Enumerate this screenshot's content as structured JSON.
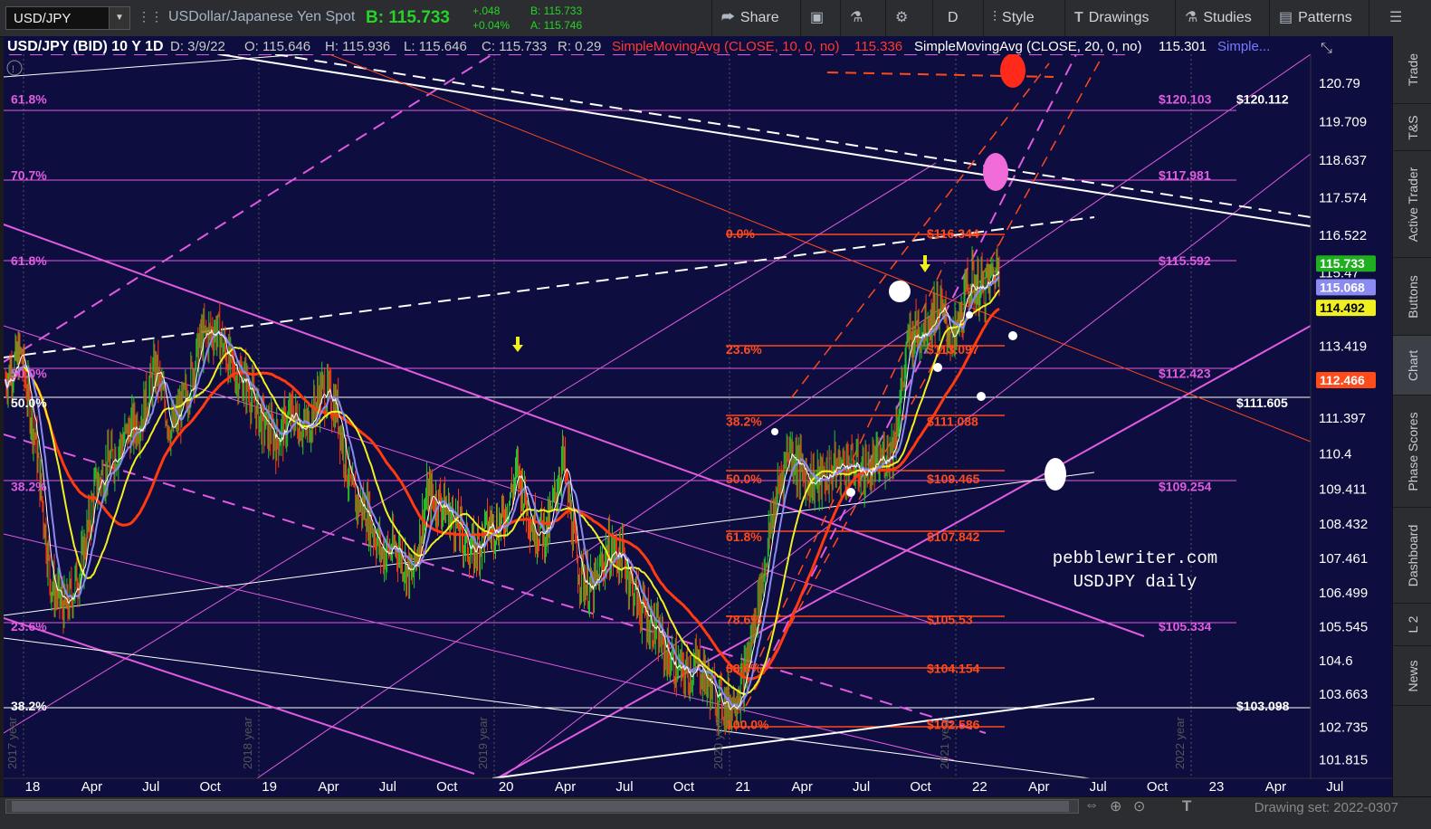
{
  "toolbar": {
    "symbol": "USD/JPY",
    "description": "USDollar/Japanese Yen Spot",
    "bid_label": "B: 115.733",
    "change_abs": "+.048",
    "change_pct": "+0.04%",
    "bid_small": "B: 115.733",
    "ask_small": "A: 115.746",
    "share": "Share",
    "interval": "D",
    "style": "Style",
    "drawings": "Drawings",
    "studies": "Studies",
    "patterns": "Patterns"
  },
  "right_tabs": [
    "Trade",
    "T&S",
    "Active Trader",
    "Buttons",
    "Chart",
    "Phase Scores",
    "Dashboard",
    "L 2",
    "News"
  ],
  "bottom": {
    "drawing_set": "Drawing set: 2022-0307"
  },
  "header": {
    "title": "USD/JPY (BID) 10 Y 1D",
    "date": "D: 3/9/22",
    "open": "O: 115.646",
    "high": "H: 115.936",
    "low": "L: 115.646",
    "close": "C: 115.733",
    "range": "R: 0.29",
    "sma10": "SimpleMovingAvg (CLOSE, 10, 0, no)",
    "sma10_val": "115.336",
    "sma20": "SimpleMovingAvg (CLOSE, 20, 0, no)",
    "sma20_val": "115.301",
    "more": "Simple..."
  },
  "watermark": {
    "line1": "pebblewriter.com",
    "line2": "USDJPY daily"
  },
  "colors": {
    "bg": "#0d0d3f",
    "magenta": "#e15be0",
    "orange": "#ff4a1a",
    "white": "#ffffff",
    "yellow": "#f0f020",
    "blue": "#8a8af0",
    "green": "#27d327"
  },
  "chart_data": {
    "type": "candlestick",
    "ylim": [
      101.3,
      121.6
    ],
    "y_ticks": [
      "120.79",
      "119.709",
      "118.637",
      "117.574",
      "116.522",
      "115.47",
      "113.419",
      "112.398",
      "111.397",
      "110.4",
      "109.411",
      "108.432",
      "107.461",
      "106.499",
      "105.545",
      "104.6",
      "103.663",
      "102.735",
      "101.815"
    ],
    "x_ticks": [
      "18",
      "Apr",
      "Jul",
      "Oct",
      "19",
      "Apr",
      "Jul",
      "Oct",
      "20",
      "Apr",
      "Jul",
      "Oct",
      "21",
      "Apr",
      "Jul",
      "Oct",
      "22",
      "Apr",
      "Jul",
      "Oct",
      "23",
      "Apr",
      "Jul"
    ],
    "year_labels": [
      "2017 year",
      "2018 year",
      "2019 year",
      "2020 year",
      "2021 year",
      "2022 year"
    ],
    "price_markers": [
      {
        "label": "115.733",
        "value": 115.733,
        "color": "#1fae1f"
      },
      {
        "label": "115.068",
        "value": 115.068,
        "color": "#8a8af0"
      },
      {
        "label": "114.492",
        "value": 114.492,
        "color": "#f0f020"
      },
      {
        "label": "112.466",
        "value": 112.466,
        "color": "#ff4a1a"
      }
    ],
    "fib_magenta": [
      {
        "label": "61.8%",
        "value": 120.112,
        "price": "$120.103"
      },
      {
        "label": "70.7%",
        "value": 117.98,
        "price": "$117.981"
      },
      {
        "label": "61.8%",
        "value": 115.592,
        "price": "$115.592"
      },
      {
        "label": "50.0%",
        "value": 112.423,
        "price": "$112.423"
      },
      {
        "label": "38.2%",
        "value": 109.254,
        "price": "$109.254"
      },
      {
        "label": "23.6%",
        "value": 105.334,
        "price": "$105.334"
      }
    ],
    "fib_white": [
      {
        "label": "50.0%",
        "value": 111.605,
        "price": "$111.605",
        "right": "$120.112"
      },
      {
        "label": "38.2%",
        "value": 103.098,
        "price": "$103.098"
      }
    ],
    "fib_orange": [
      {
        "label": "0.0%",
        "value": 116.344,
        "price": "$116.344"
      },
      {
        "label": "23.6%",
        "value": 113.097,
        "price": "$113.097"
      },
      {
        "label": "38.2%",
        "value": 111.088,
        "price": "$111.088"
      },
      {
        "label": "50.0%",
        "value": 109.465,
        "price": "$109.465"
      },
      {
        "label": "61.8%",
        "value": 107.842,
        "price": "$107.842"
      },
      {
        "label": "78.6%",
        "value": 105.53,
        "price": "$105.53"
      },
      {
        "label": "88.6%",
        "value": 104.154,
        "price": "$104.154"
      },
      {
        "label": "100.0%",
        "value": 102.586,
        "price": "$102.586"
      }
    ],
    "right_white_label": "$120.112",
    "series": [
      {
        "name": "USD/JPY",
        "values": [
          112.5,
          113.2,
          110.8,
          106.8,
          106.0,
          107.2,
          109.5,
          110.2,
          110.9,
          111.4,
          112.8,
          111.0,
          112.0,
          113.6,
          113.9,
          112.8,
          112.4,
          111.3,
          110.8,
          111.5,
          111.1,
          112.2,
          111.7,
          109.2,
          108.8,
          107.6,
          107.8,
          106.9,
          109.2,
          109.0,
          108.4,
          107.6,
          108.3,
          108.5,
          109.9,
          108.4,
          108.2,
          110.3,
          107.2,
          106.5,
          107.7,
          107.5,
          106.2,
          105.6,
          104.7,
          104.2,
          104.5,
          103.7,
          103.3,
          104.0,
          106.2,
          108.8,
          110.6,
          109.8,
          109.6,
          110.0,
          110.1,
          109.9,
          110.1,
          110.7,
          113.6,
          114.0,
          114.5,
          113.5,
          115.2,
          115.0,
          115.7
        ]
      }
    ]
  }
}
